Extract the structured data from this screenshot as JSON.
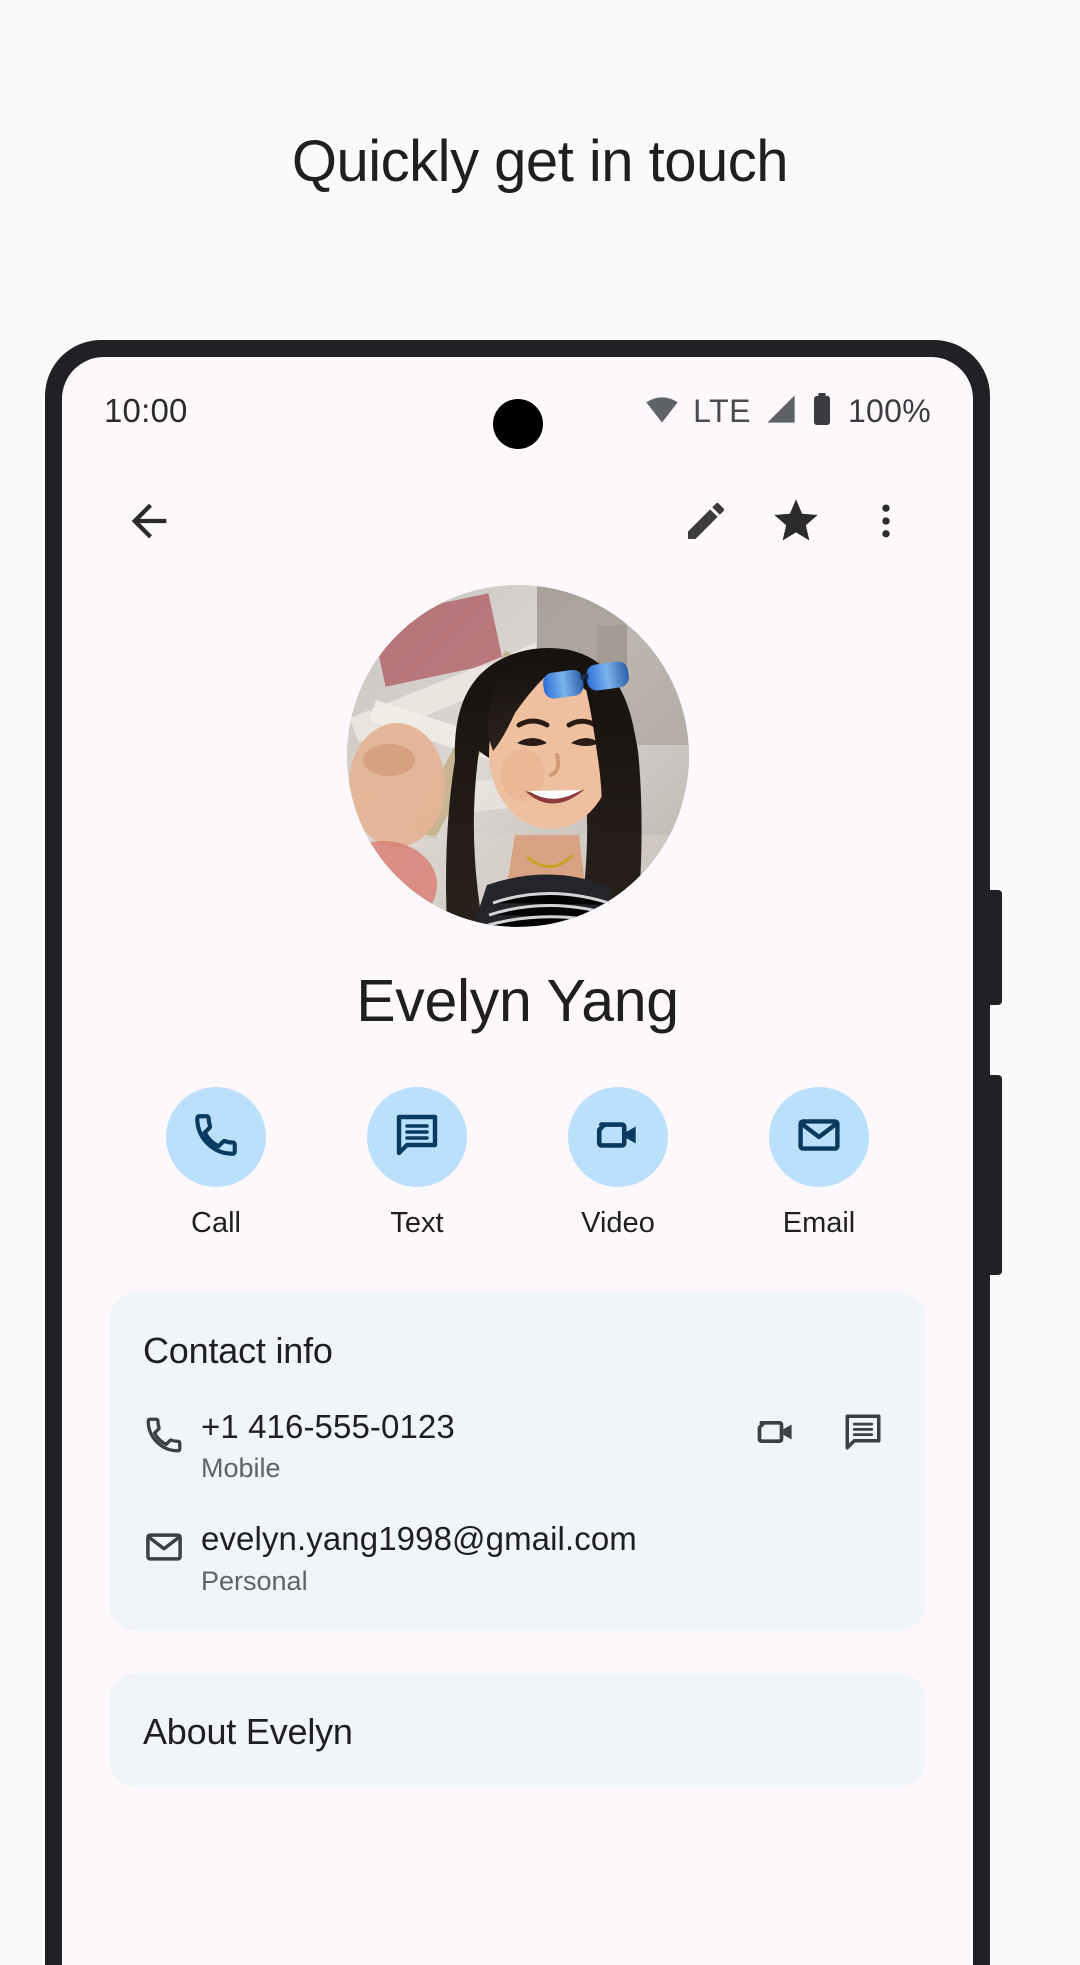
{
  "headline": "Quickly get in touch",
  "phone": {
    "statusbar": {
      "time": "10:00",
      "network_label": "LTE",
      "battery_label": "100%",
      "icons": [
        "wifi-icon",
        "cellular-signal-icon",
        "battery-icon"
      ]
    },
    "appbar": {
      "back_icon": "back-arrow-icon",
      "edit_icon": "pencil-edit-icon",
      "favorite_icon": "star-filled-icon",
      "overflow_icon": "more-vertical-icon"
    },
    "contact": {
      "name": "Evelyn Yang",
      "avatar_alt": "contact-photo"
    },
    "quick_actions": [
      {
        "label": "Call",
        "icon": "phone-icon"
      },
      {
        "label": "Text",
        "icon": "message-icon"
      },
      {
        "label": "Video",
        "icon": "video-camera-icon"
      },
      {
        "label": "Email",
        "icon": "envelope-icon"
      }
    ],
    "contact_info": {
      "title": "Contact info",
      "rows": [
        {
          "icon": "phone-icon",
          "primary": "+1 416-555-0123",
          "secondary": "Mobile",
          "actions": [
            "video-camera-icon",
            "message-icon"
          ]
        },
        {
          "icon": "envelope-icon",
          "primary": "evelyn.yang1998@gmail.com",
          "secondary": "Personal",
          "actions": []
        }
      ]
    },
    "about": {
      "title": "About Evelyn"
    }
  },
  "colors": {
    "page_background": "#FAFAFA",
    "device_frame": "#202124",
    "screen_background": "#FDF8FB",
    "action_circle": "#BBE0FB",
    "action_icon": "#0B3A60",
    "card_background": "#F1F5F8",
    "text_primary": "#1F1F21",
    "text_secondary": "#5F6368"
  }
}
